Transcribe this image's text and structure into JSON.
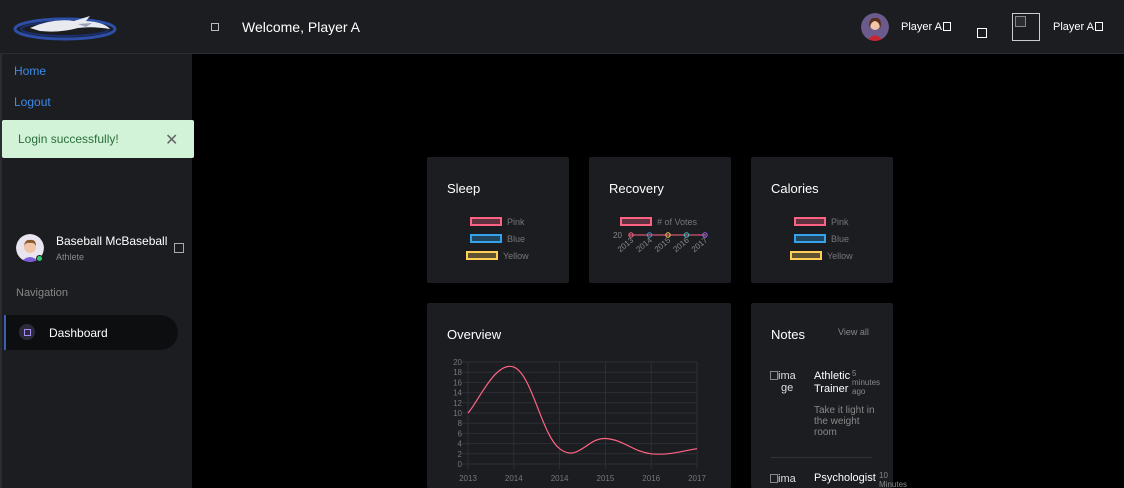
{
  "header": {
    "welcome": "Welcome, Player A",
    "user_name": "Player A",
    "user_name_2": "Player A"
  },
  "sidebar": {
    "links": [
      {
        "label": "Home"
      },
      {
        "label": "Logout"
      }
    ],
    "toast": {
      "message": "Login successfully!",
      "close": "✕"
    },
    "profile": {
      "name": "Baseball McBaseball",
      "role": "Athlete"
    },
    "nav_heading": "Navigation",
    "nav_items": [
      {
        "label": "Dashboard"
      }
    ]
  },
  "cards": {
    "sleep": {
      "title": "Sleep",
      "legend": [
        {
          "label": "Pink",
          "color": "#ff6384"
        },
        {
          "label": "Blue",
          "color": "#36a2eb"
        },
        {
          "label": "Yellow",
          "color": "#ffce56"
        }
      ]
    },
    "recovery": {
      "title": "Recovery",
      "legend_label": "# of Votes",
      "y_tick": "20",
      "x_ticks": [
        "2013",
        "2014",
        "2015",
        "2016",
        "2017"
      ],
      "point_colors": [
        "#ff6384",
        "#36a2eb",
        "#ffce56",
        "#4bc0c0",
        "#9966ff"
      ]
    },
    "calories": {
      "title": "Calories",
      "legend": [
        {
          "label": "Pink",
          "color": "#ff6384"
        },
        {
          "label": "Blue",
          "color": "#36a2eb"
        },
        {
          "label": "Yellow",
          "color": "#ffce56"
        }
      ]
    },
    "overview": {
      "title": "Overview"
    },
    "notes": {
      "title": "Notes",
      "view_all": "View all",
      "items": [
        {
          "image_alt_1": "ima",
          "image_alt_2": "ge",
          "title_1": "Athletic",
          "title_2": "Trainer",
          "time_1": "5",
          "time_2": "minutes",
          "time_3": "ago",
          "text_1": "Take it light in",
          "text_2": "the weight",
          "text_3": "room"
        },
        {
          "image_alt_1": "ima",
          "title_1": "Psychologist",
          "time_1": "10",
          "time_2": "Minutes"
        }
      ]
    }
  },
  "chart_data": {
    "type": "line",
    "title": "Overview",
    "categories": [
      "2013",
      "2014",
      "2014",
      "2015",
      "2016",
      "2017"
    ],
    "series": [
      {
        "values": [
          10,
          19,
          3,
          5,
          2,
          3
        ],
        "color": "#ff6384"
      }
    ],
    "y_ticks": [
      "0",
      "2",
      "4",
      "6",
      "8",
      "10",
      "12",
      "14",
      "16",
      "18",
      "20"
    ],
    "ylim": [
      0,
      20
    ],
    "grid": true
  }
}
